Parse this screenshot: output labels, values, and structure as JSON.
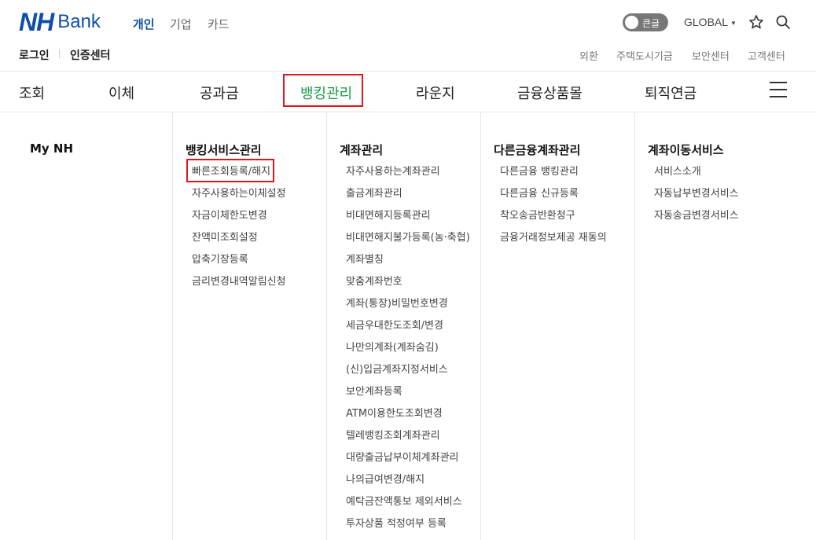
{
  "brand": {
    "nh": "NH",
    "bank": "Bank"
  },
  "scopes": [
    "개인",
    "기업",
    "카드"
  ],
  "toggle_label": "큰글",
  "region": "GLOBAL",
  "util_left": [
    "로그인",
    "인증센터"
  ],
  "util_right": [
    "외환",
    "주택도시기금",
    "보안센터",
    "고객센터"
  ],
  "gnb": [
    "조회",
    "이체",
    "공과금",
    "뱅킹관리",
    "라운지",
    "금융상품몰",
    "퇴직연금"
  ],
  "gnb_active": "뱅킹관리",
  "columns": [
    {
      "title": "My NH",
      "items": []
    },
    {
      "title": "뱅킹서비스관리",
      "items": [
        "빠른조회등록/해지",
        "자주사용하는이체설정",
        "자금이체한도변경",
        "잔액미조회설정",
        "압축기장등록",
        "금리변경내역알림신청"
      ]
    },
    {
      "title": "계좌관리",
      "items": [
        "자주사용하는계좌관리",
        "출금계좌관리",
        "비대면해지등록관리",
        "비대면해지불가등록(농·축협)",
        "계좌별칭",
        "맞춤계좌번호",
        "계좌(통장)비밀번호변경",
        "세금우대한도조회/변경",
        "나만의계좌(계좌숨김)",
        "(신)입금계좌지정서비스",
        "보안계좌등록",
        "ATM이용한도조회변경",
        "텔레뱅킹조회계좌관리",
        "대량출금납부이체계좌관리",
        "나의급여변경/해지",
        "예탁금잔액통보 제외서비스",
        "투자상품 적정여부 등록"
      ]
    },
    {
      "title": "다른금융계좌관리",
      "items": [
        "다른금융 뱅킹관리",
        "다른금융 신규등록",
        "착오송금반환청구",
        "금융거래정보제공 재동의"
      ]
    },
    {
      "title": "계좌이동서비스",
      "items": [
        "서비스소개",
        "자동납부변경서비스",
        "자동송금변경서비스"
      ]
    }
  ],
  "colors": {
    "brand_blue": "#0f4fa8",
    "active_green": "#1a9b4a",
    "highlight_red": "#e0151e"
  }
}
